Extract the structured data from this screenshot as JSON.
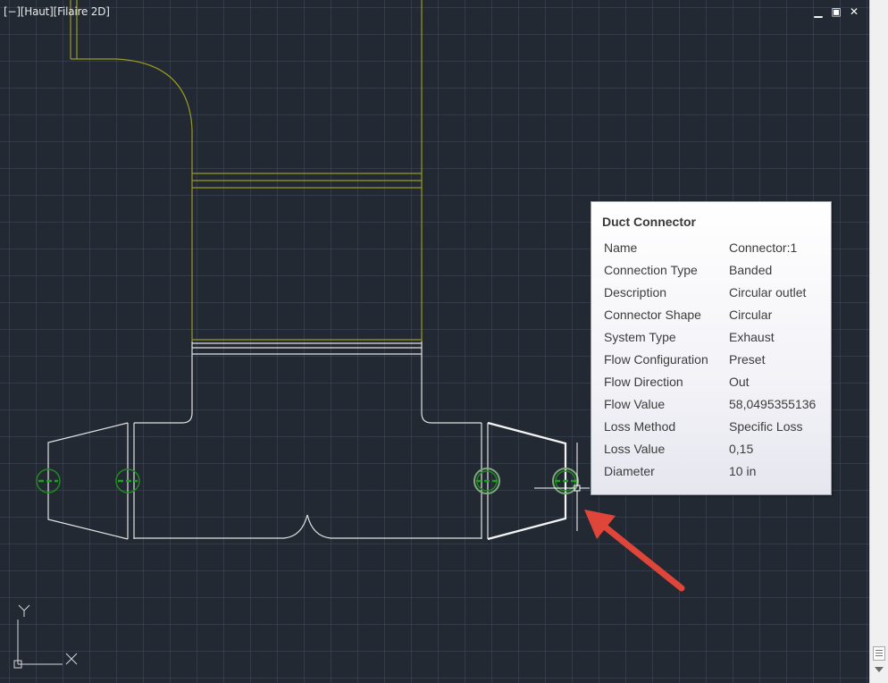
{
  "viewport": {
    "label": "[−][Haut][Filaire 2D]",
    "controls": {
      "minimize": "▁",
      "restore": "▣",
      "close": "✕"
    }
  },
  "ucs": {
    "y_label": "Y",
    "x_label": "X"
  },
  "tooltip": {
    "title": "Duct Connector",
    "properties": [
      {
        "name": "Name",
        "value": "Connector:1"
      },
      {
        "name": "Connection Type",
        "value": "Banded"
      },
      {
        "name": "Description",
        "value": "Circular outlet"
      },
      {
        "name": "Connector Shape",
        "value": "Circular"
      },
      {
        "name": "System Type",
        "value": "Exhaust"
      },
      {
        "name": "Flow Configuration",
        "value": "Preset"
      },
      {
        "name": "Flow Direction",
        "value": "Out"
      },
      {
        "name": "Flow Value",
        "value": "58,0495355136"
      },
      {
        "name": "Loss Method",
        "value": "Specific Loss"
      },
      {
        "name": "Loss Value",
        "value": "0,15"
      },
      {
        "name": "Diameter",
        "value": "10 in"
      }
    ]
  },
  "colors": {
    "background": "#222933",
    "duct_yellow": "#9a9a22",
    "duct_white": "#e6e6e6",
    "connector_green": "#1f8a1f",
    "arrow_red": "#e0453a"
  }
}
